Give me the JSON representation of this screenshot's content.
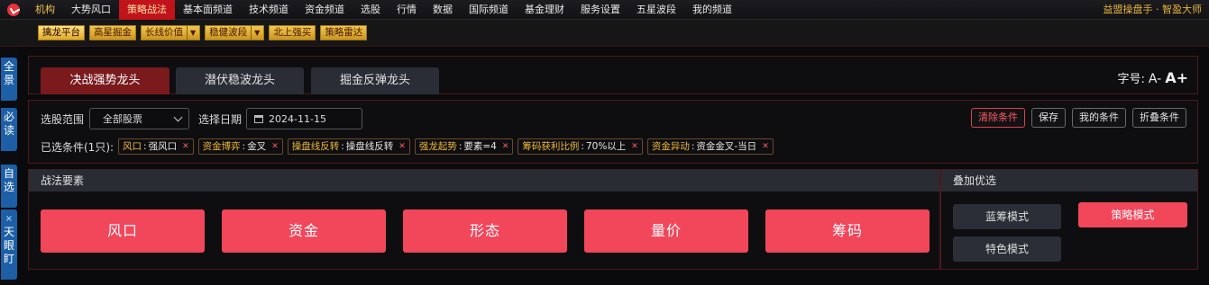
{
  "menu": {
    "items": [
      "机构",
      "大势风口",
      "策略战法",
      "基本面频道",
      "技术频道",
      "资金频道",
      "选股",
      "行情",
      "数据",
      "国际频道",
      "基金理财",
      "服务设置",
      "五星波段",
      "我的频道"
    ],
    "active": "策略战法",
    "brand": "益盟操盘手 · 智盈大师"
  },
  "subbar": {
    "chips": [
      {
        "label": "擒龙平台",
        "dropdown": false,
        "selected": true
      },
      {
        "label": "高星掘金",
        "dropdown": false,
        "selected": false
      },
      {
        "label": "长线价值",
        "dropdown": true,
        "selected": false
      },
      {
        "label": "稳健波段",
        "dropdown": true,
        "selected": false
      },
      {
        "label": "北上强买",
        "dropdown": false,
        "selected": false
      },
      {
        "label": "策略雷达",
        "dropdown": false,
        "selected": false
      }
    ]
  },
  "sidebar": {
    "tabs": [
      "全景",
      "必读",
      "自选",
      "天眼盯"
    ],
    "close_glyph": "×"
  },
  "tabs": [
    "决战强势龙头",
    "潜伏稳波龙头",
    "掘金反弹龙头"
  ],
  "font_size": {
    "label": "字号:",
    "smaller": "A-",
    "larger": "A+"
  },
  "filters": {
    "range_label": "选股范围",
    "range_value": "全部股票",
    "date_label": "选择日期",
    "date_value": "2024-11-15",
    "selected_label": "已选条件(1只):",
    "tags": [
      {
        "k": "风口",
        "v": "强风口"
      },
      {
        "k": "资金博弈",
        "v": "金叉"
      },
      {
        "k": "操盘线反转",
        "v": "操盘线反转"
      },
      {
        "k": "强龙起势",
        "v": "要素=4"
      },
      {
        "k": "筹码获利比例",
        "v": "70%以上"
      },
      {
        "k": "资金异动",
        "v": "资金金叉-当日"
      }
    ]
  },
  "actions": [
    "清除条件",
    "保存",
    "我的条件",
    "折叠条件"
  ],
  "tactics": {
    "title": "战法要素",
    "buttons": [
      "风口",
      "资金",
      "形态",
      "量价",
      "筹码"
    ]
  },
  "overlay": {
    "title": "叠加优选",
    "modes": [
      "蓝筹模式",
      "策略模式",
      "特色模式"
    ],
    "active_mode": "策略模式"
  },
  "colors": {
    "accent_red": "#f2465a",
    "menu_active": "#c0131b",
    "chip_gold": "#e0a92a",
    "sidebar_blue": "#1c5fa6"
  }
}
